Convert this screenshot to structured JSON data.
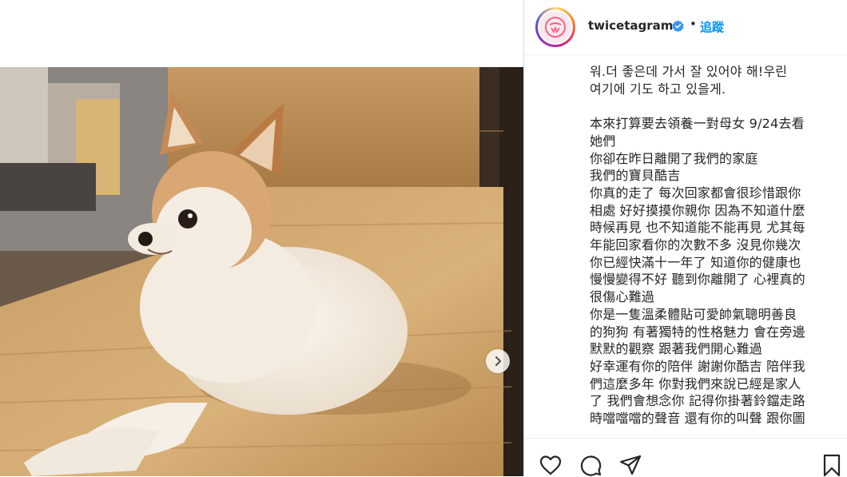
{
  "post": {
    "username": "twicetagram",
    "dot": "•",
    "follow_label": "追蹤",
    "caption": "워.더 좋은데 가서 잘 있어야 해!우린\n여기에 기도 하고 있을게.\n\n本來打算要去領養一對母女 9/24去看\n她們\n你卻在昨日離開了我們的家庭\n我們的寶貝酷吉\n你真的走了 每次回家都會很珍惜跟你\n相處 好好摸摸你親你 因為不知道什麼\n時候再見 也不知道能不能再見 尤其每\n年能回家看你的次數不多 沒見你幾次\n你已經快滿十一年了 知道你的健康也\n慢慢變得不好 聽到你離開了 心裡真的\n很傷心難過\n你是一隻溫柔體貼可愛帥氣聰明善良\n的狗狗 有著獨特的性格魅力 會在旁邊\n默默的觀察 跟著我們開心難過\n好幸運有你的陪伴 謝謝你酷吉 陪伴我\n們這麼多年 你對我們來說已經是家人\n了 我們會想念你 記得你掛著鈴鐺走路\n時噹噹噹的聲音 還有你的叫聲 跟你圖"
  },
  "icons": {
    "avatar": "twice-logo-icon",
    "verified": "verified-badge-icon",
    "next": "chevron-right-icon",
    "like": "heart-icon",
    "comment": "comment-icon",
    "share": "share-icon",
    "save": "bookmark-icon"
  },
  "colors": {
    "follow": "#0095f6",
    "verified": "#3897f0",
    "text": "#262626"
  }
}
